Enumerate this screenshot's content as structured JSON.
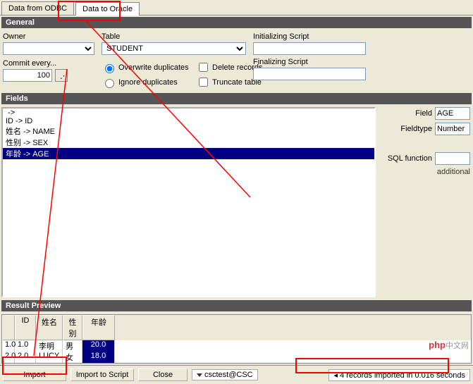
{
  "tabs": {
    "odbc": "Data from ODBC",
    "oracle": "Data to Oracle"
  },
  "general": {
    "title": "General",
    "owner_label": "Owner",
    "table_label": "Table",
    "table_value": "STUDENT",
    "commit_label": "Commit every...",
    "commit_value": "100",
    "overwrite": "Overwrite duplicates",
    "ignore": "Ignore duplicates",
    "delete": "Delete records",
    "truncate": "Truncate table",
    "init_script": "Initializing Script",
    "final_script": "Finalizing Script"
  },
  "fields": {
    "title": "Fields",
    "items": [
      {
        "text": " -> ",
        "selected": false
      },
      {
        "text": "ID -> ID",
        "selected": false
      },
      {
        "text": "姓名 -> NAME",
        "selected": false
      },
      {
        "text": "性别 -> SEX",
        "selected": false
      },
      {
        "text": "年龄 -> AGE",
        "selected": true
      }
    ],
    "field_label": "Field",
    "field_value": "AGE",
    "fieldtype_label": "Fieldtype",
    "fieldtype_value": "Number",
    "sql_label": "SQL function",
    "additional": "additional"
  },
  "result": {
    "title": "Result Preview",
    "headers": [
      "",
      "ID",
      "姓名",
      "性别",
      "年龄"
    ],
    "rows": [
      [
        "1.0",
        "1.0",
        "李明",
        "男",
        "20.0"
      ],
      [
        "2.0",
        "2.0",
        "LUCY",
        "女",
        "18.0"
      ]
    ]
  },
  "buttons": {
    "import": "Import",
    "script": "Import to Script",
    "close": "Close"
  },
  "connection": "csctest@CSC",
  "status": "4 records imported in 0.016 seconds",
  "watermark": {
    "brand": "php",
    "suffix": "中文网"
  }
}
